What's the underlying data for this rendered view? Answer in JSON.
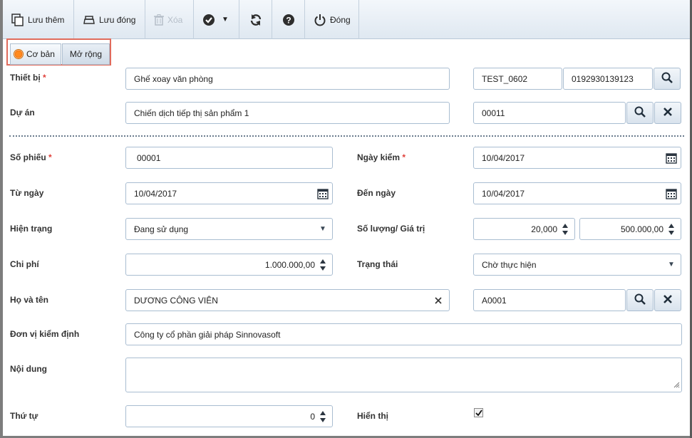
{
  "toolbar": {
    "save_more": "Lưu thêm",
    "save_close": "Lưu đóng",
    "delete": "Xóa",
    "close": "Đóng"
  },
  "tabs": {
    "basic": "Cơ bản",
    "extended": "Mở rộng"
  },
  "form": {
    "device": {
      "label": "Thiết bị",
      "value": "Ghế xoay văn phòng",
      "code": "TEST_0602",
      "serial": "0192930139123"
    },
    "project": {
      "label": "Dự án",
      "value": "Chiến dịch tiếp thị sản phẩm 1",
      "code": "00011"
    },
    "ticket_no": {
      "label": "Số phiếu",
      "value": "00001"
    },
    "check_date": {
      "label": "Ngày kiểm",
      "value": "10/04/2017"
    },
    "from_date": {
      "label": "Từ ngày",
      "value": "10/04/2017"
    },
    "to_date": {
      "label": "Đến ngày",
      "value": "10/04/2017"
    },
    "condition": {
      "label": "Hiện trạng",
      "value": "Đang sử dụng"
    },
    "quantity_value": {
      "label": "Số lượng/ Giá trị",
      "quantity": "20,000",
      "value": "500.000,00"
    },
    "cost": {
      "label": "Chi phí",
      "value": "1.000.000,00"
    },
    "status": {
      "label": "Trạng thái",
      "value": "Chờ thực hiện"
    },
    "full_name": {
      "label": "Họ và tên",
      "value": "DƯƠNG CÔNG VIÊN",
      "code": "A0001"
    },
    "inspection_unit": {
      "label": "Đơn vị kiểm định",
      "value": "Công ty cổ phần giải pháp Sinnovasoft"
    },
    "content": {
      "label": "Nội dung",
      "value": ""
    },
    "order": {
      "label": "Thứ tự",
      "value": "0"
    },
    "display": {
      "label": "Hiển thị",
      "checked": true
    }
  },
  "required_mark": "*",
  "colors": {
    "accent_border": "#e06b5c",
    "radio_orange": "#f46a00",
    "required": "#e0403a"
  }
}
